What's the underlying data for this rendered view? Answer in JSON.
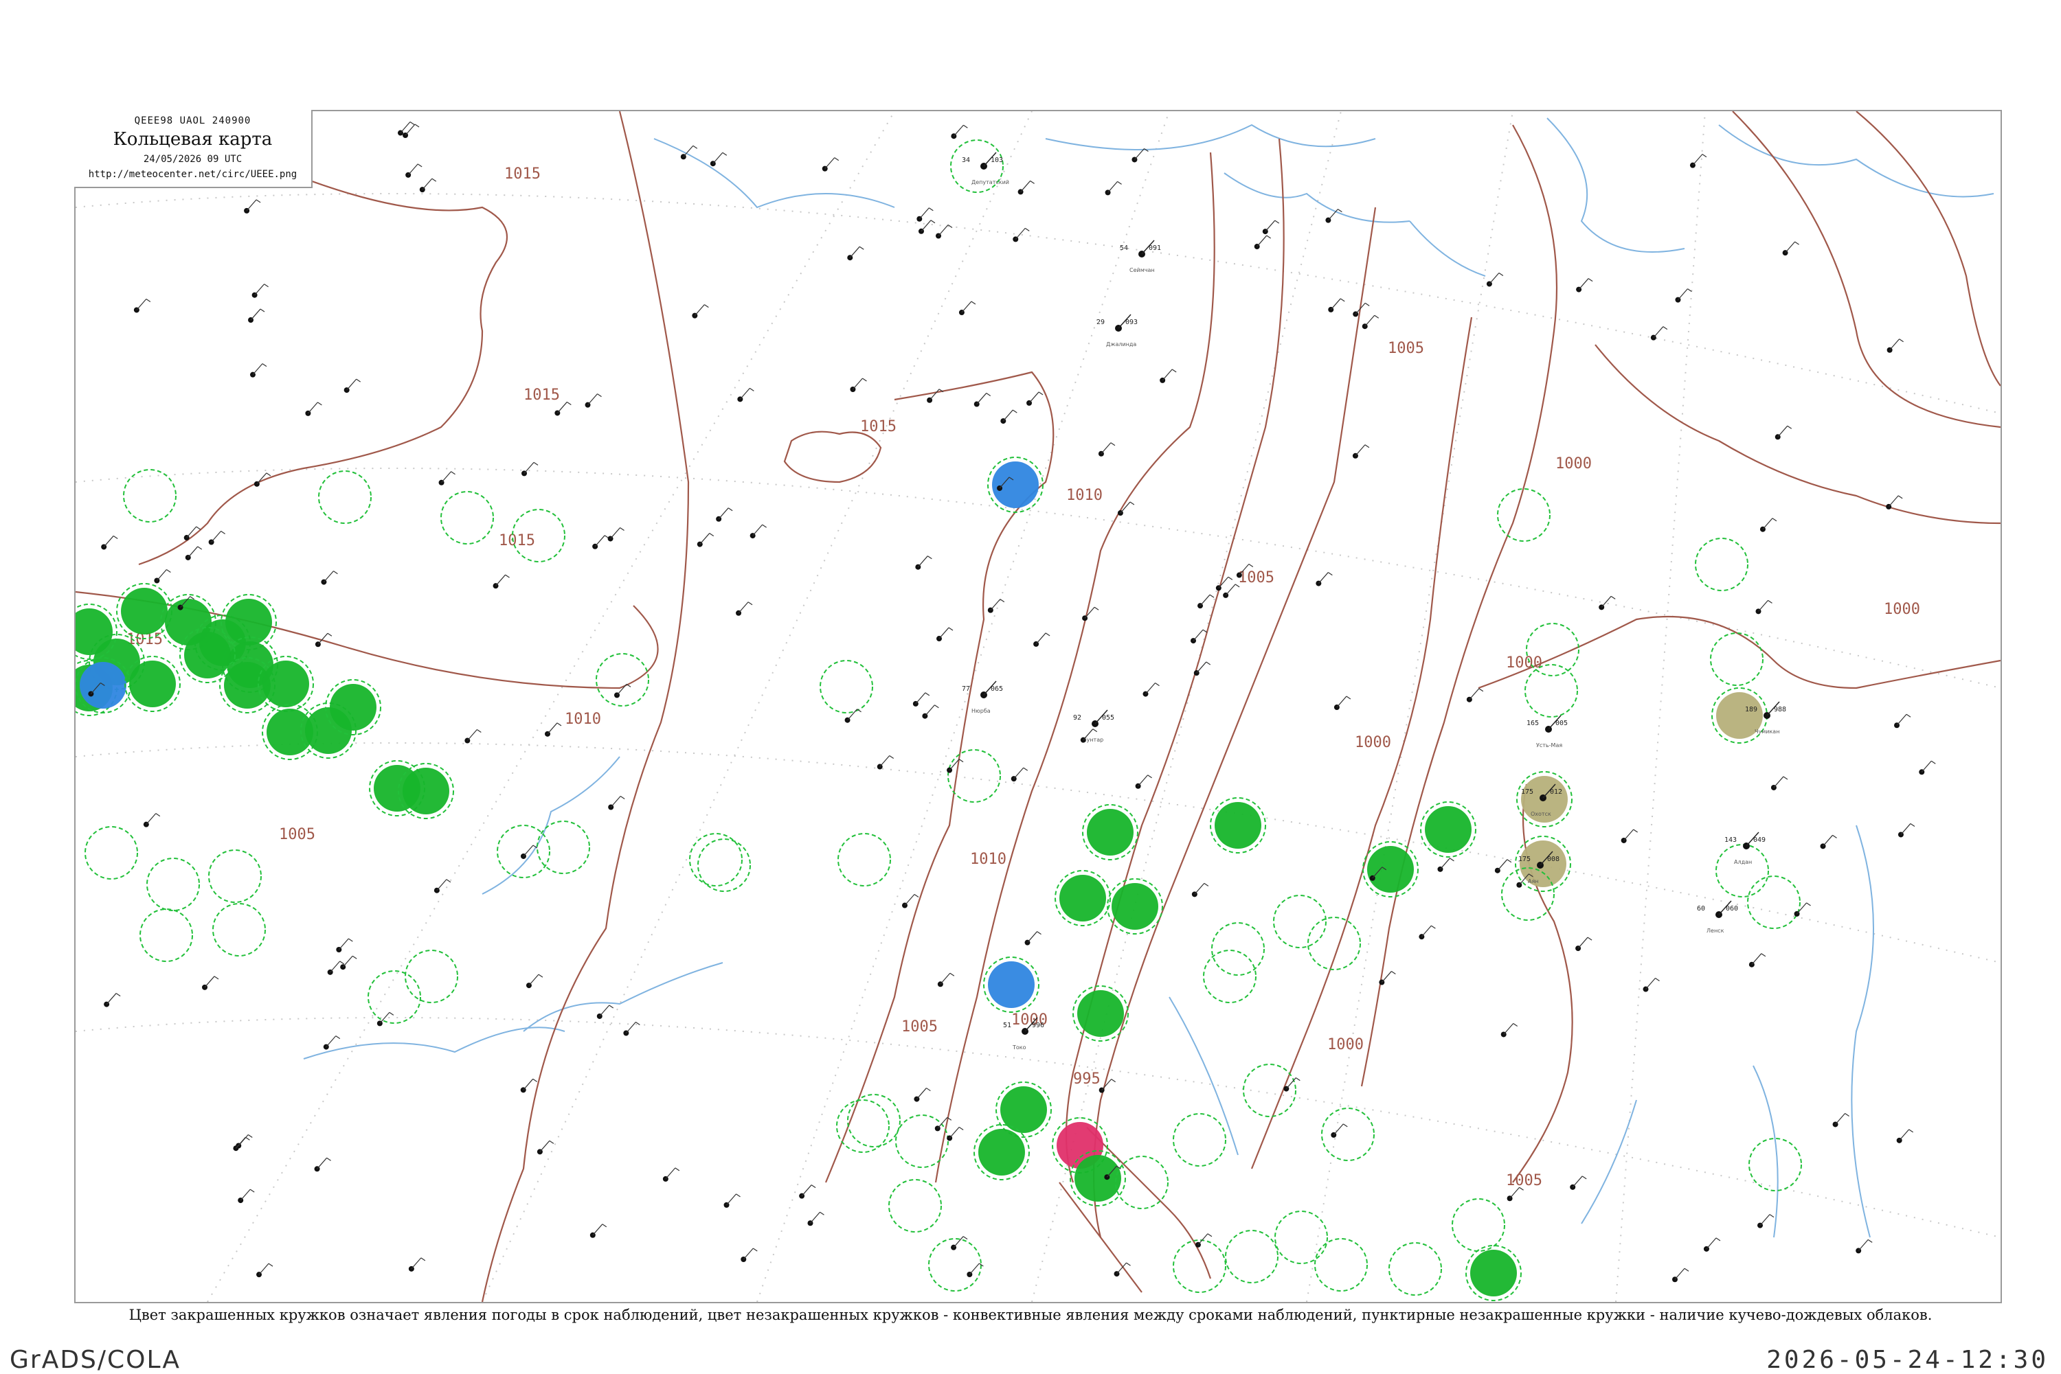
{
  "header": {
    "code": "QEEE98 UAOL 240900",
    "title": "Кольцевая карта",
    "timestamp": "24/05/2026 09 UTC",
    "url": "http://meteocenter.net/circ/UEEE.png"
  },
  "caption": "Цвет закрашенных кружков означает явления погоды в срок наблюдений, цвет незакрашенных кружков - конвективные явления между сроками наблюдений, пунктирные незакрашенные кружки - наличие кучево-дождевых облаков.",
  "footer": {
    "left": "GrADS/COLA",
    "right": "2026-05-24-12:30"
  },
  "colors": {
    "isobar": "#a0584a",
    "water": "#7fb3e0",
    "fill_green": "#17b52b",
    "fill_blue": "#2f86e0",
    "fill_red": "#e0306a",
    "fill_khaki": "#b6b07a",
    "dashed_green": "#22c03a",
    "grid_dots": "#bfbfbf"
  },
  "isobar_labels": [
    "1015",
    "1015",
    "1015",
    "1015",
    "1015",
    "1010",
    "1010",
    "1010",
    "1005",
    "1005",
    "1005",
    "1005",
    "1000",
    "1000",
    "1000",
    "1000",
    "1000",
    "995",
    "1005",
    "1000"
  ],
  "station_samples": [
    {
      "p": "103",
      "t": "34",
      "name": "Депутатский"
    },
    {
      "p": "091",
      "t": "54",
      "name": "Сеймчан"
    },
    {
      "p": "093",
      "t": "29",
      "name": "Джалинда"
    },
    {
      "p": "065",
      "t": "77",
      "name": "Нюрба"
    },
    {
      "p": "055",
      "t": "92",
      "name": "Сунтар"
    },
    {
      "p": "996",
      "t": "51",
      "name": "Токо"
    },
    {
      "p": "005",
      "t": "165",
      "name": "Усть-Мая"
    },
    {
      "p": "012",
      "t": "175",
      "name": "Охотск"
    },
    {
      "p": "008",
      "t": "175",
      "name": "Аян"
    },
    {
      "p": "988",
      "t": "189",
      "name": "Чумикан"
    },
    {
      "p": "049",
      "t": "143",
      "name": "Алдан"
    },
    {
      "p": "060",
      "t": "60",
      "name": "Ленск"
    }
  ]
}
